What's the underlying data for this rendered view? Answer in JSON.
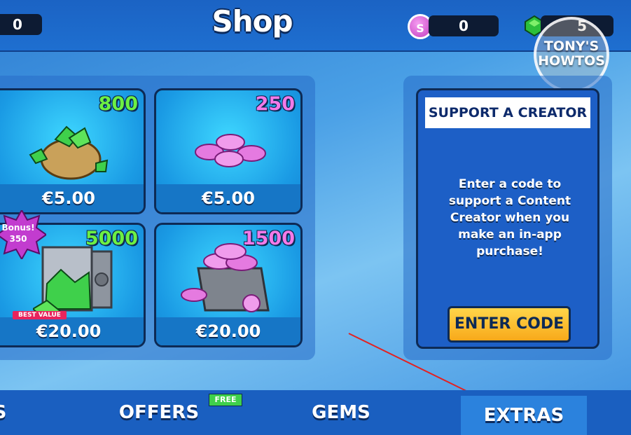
{
  "header": {
    "title": "Shop",
    "left_counter": "0",
    "coins_counter": "0",
    "gems_counter": "5",
    "coin_symbol": "S"
  },
  "watermark": {
    "line1": "TONY'S",
    "line2": "HOWTOS"
  },
  "cards": [
    {
      "amount": "800",
      "price": "€5.00",
      "currency": "gems",
      "icon": "gem-bag-icon"
    },
    {
      "amount": "250",
      "price": "€5.00",
      "currency": "coins",
      "icon": "coin-pile-icon"
    },
    {
      "amount": "5000",
      "price": "€20.00",
      "currency": "gems",
      "icon": "gem-vault-icon"
    },
    {
      "amount": "1500",
      "price": "€20.00",
      "currency": "coins",
      "icon": "coin-crate-icon"
    }
  ],
  "bonus": {
    "label": "Bonus!",
    "value": "350"
  },
  "best_value": "BEST VALUE",
  "support": {
    "title": "SUPPORT A CREATOR",
    "text": "Enter a code to support a Content Creator when you make an in-app purchase!",
    "button": "ENTER CODE"
  },
  "tabs": [
    {
      "label": "S",
      "active": false
    },
    {
      "label": "OFFERS",
      "active": false
    },
    {
      "label": "GEMS",
      "active": false
    },
    {
      "label": "EXTRAS",
      "active": true
    }
  ],
  "free_badge": "FREE",
  "colors": {
    "gem_green": "#6cf043",
    "coin_pink": "#f37ae8",
    "button_yellow": "#ffc732"
  }
}
